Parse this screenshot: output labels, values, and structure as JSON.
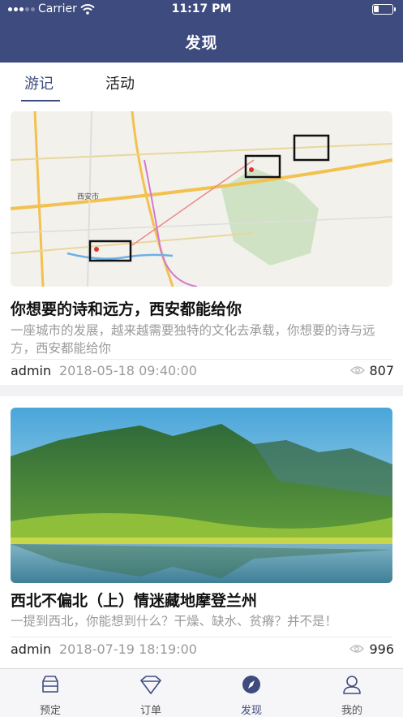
{
  "status_bar": {
    "carrier": "Carrier",
    "time": "11:17 PM"
  },
  "nav": {
    "title": "发现"
  },
  "tabs": [
    {
      "label": "游记",
      "active": true
    },
    {
      "label": "活动",
      "active": false
    }
  ],
  "articles": [
    {
      "title": "你想要的诗和远方，西安都能给你",
      "summary": "一座城市的发展，越来越需要独特的文化去承载，你想要的诗与远方，西安都能给你",
      "author": "admin",
      "date": "2018-05-18 09:40:00",
      "views": "807",
      "image": "xian-map-thumbnail",
      "map_labels": {
        "city": "西安市"
      }
    },
    {
      "title": "西北不偏北（上）情迷藏地摩登兰州",
      "summary": "一提到西北，你能想到什么？干燥、缺水、贫瘠？并不是！",
      "author": "admin",
      "date": "2018-07-19 18:19:00",
      "views": "996",
      "image": "mountain-lake-thumbnail"
    }
  ],
  "tabbar": [
    {
      "label": "预定",
      "icon": "car-icon",
      "active": false
    },
    {
      "label": "订单",
      "icon": "diamond-icon",
      "active": false
    },
    {
      "label": "发现",
      "icon": "compass-icon",
      "active": true
    },
    {
      "label": "我的",
      "icon": "user-icon",
      "active": false
    }
  ],
  "colors": {
    "brand": "#3e4b7e",
    "muted_text": "#9a9a9a",
    "background": "#f2f2f4"
  }
}
